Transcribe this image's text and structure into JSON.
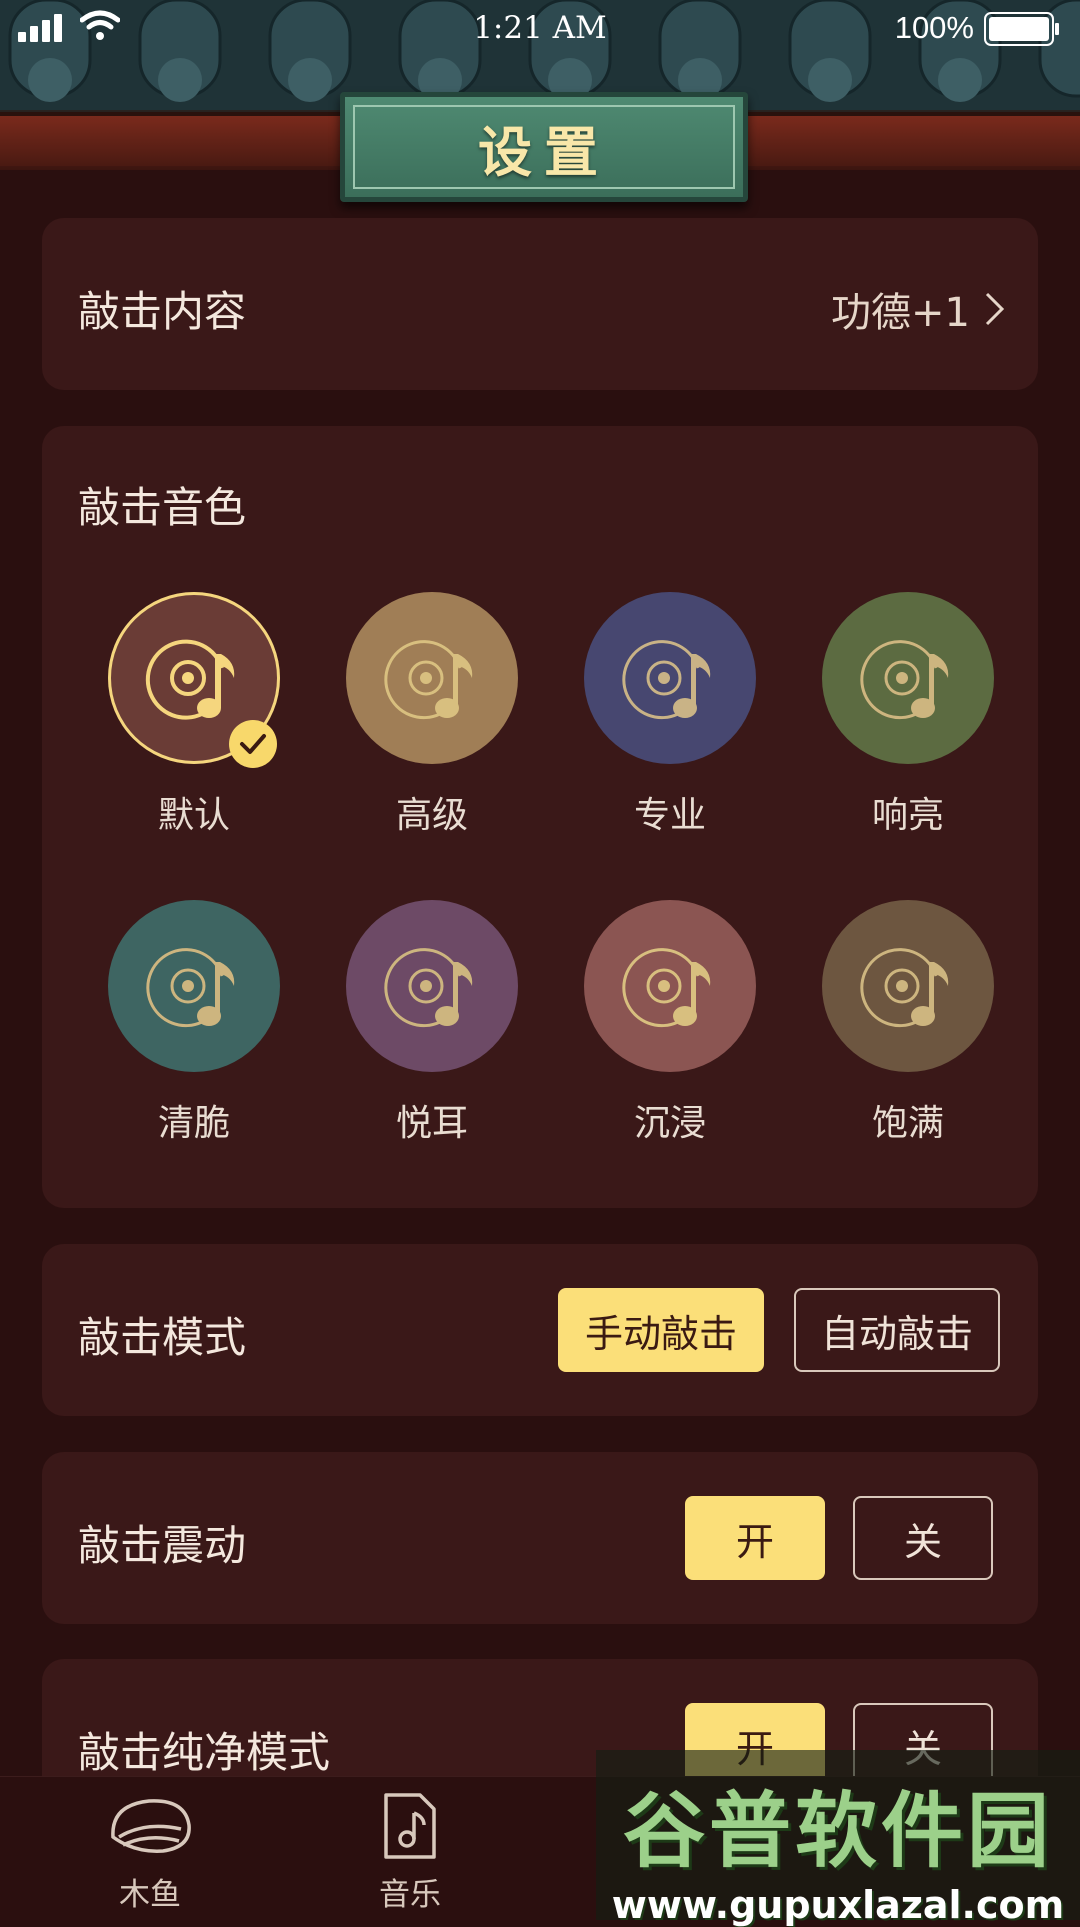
{
  "status_bar": {
    "time": "1:21 AM",
    "battery": "100%"
  },
  "header": {
    "title": "设置"
  },
  "settings": {
    "content": {
      "label": "敲击内容",
      "value": "功德+1"
    },
    "sound": {
      "label": "敲击音色",
      "options": [
        {
          "name": "默认",
          "color": "#6a3c36",
          "selected": true
        },
        {
          "name": "高级",
          "color": "#a07e56",
          "selected": false
        },
        {
          "name": "专业",
          "color": "#474770",
          "selected": false
        },
        {
          "name": "响亮",
          "color": "#5c6b41",
          "selected": false
        },
        {
          "name": "清脆",
          "color": "#3e6562",
          "selected": false
        },
        {
          "name": "悦耳",
          "color": "#6d4a66",
          "selected": false
        },
        {
          "name": "沉浸",
          "color": "#8b5552",
          "selected": false
        },
        {
          "name": "饱满",
          "color": "#6d5640",
          "selected": false
        }
      ]
    },
    "mode": {
      "label": "敲击模式",
      "manual": "手动敲击",
      "auto": "自动敲击",
      "selected": "manual"
    },
    "vibrate": {
      "label": "敲击震动",
      "on": "开",
      "off": "关",
      "selected": "on"
    },
    "pure": {
      "label": "敲击纯净模式",
      "on": "开",
      "off": "关",
      "selected": "on"
    }
  },
  "tabs": [
    {
      "label": "木鱼",
      "icon": "wooden-fish-icon"
    },
    {
      "label": "音乐",
      "icon": "music-file-icon"
    }
  ],
  "watermark": {
    "title": "谷普软件园",
    "url": "www.gupuxlazal.com"
  },
  "colors": {
    "background": "#2a0f0f",
    "card": "#3a1818",
    "accent": "#fbdf79",
    "plaque": "#3b6e5a"
  }
}
